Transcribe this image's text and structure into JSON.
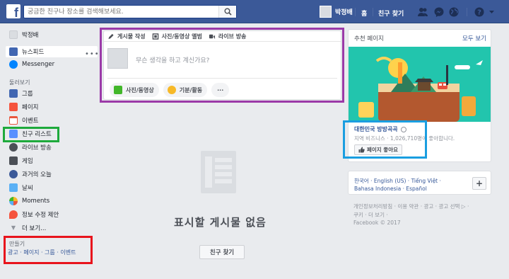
{
  "topbar": {
    "search_placeholder": "궁금한 친구나 장소를 검색해보세요.",
    "user_name": "박정배",
    "home": "홈",
    "find_friends": "친구 찾기"
  },
  "sidebar": {
    "profile_name": "박정배",
    "items_top": [
      {
        "label": "뉴스피드",
        "icon": "newsfeed-icon",
        "color": "#4267b2"
      },
      {
        "label": "Messenger",
        "icon": "messenger-icon",
        "color": "#0084ff"
      }
    ],
    "explore_title": "둘러보기",
    "items": [
      {
        "label": "그룹",
        "icon": "groups-icon",
        "color": "#4267b2"
      },
      {
        "label": "페이지",
        "icon": "pages-icon",
        "color": "#f5533d"
      },
      {
        "label": "이벤트",
        "icon": "events-icon",
        "color": "#e9573e"
      },
      {
        "label": "친구 리스트",
        "icon": "friend-list-icon",
        "color": "#5890ff"
      },
      {
        "label": "라이브 방송",
        "icon": "live-icon",
        "color": "#4b4f56"
      },
      {
        "label": "게임",
        "icon": "games-icon",
        "color": "#4b4f56"
      },
      {
        "label": "과거의 오늘",
        "icon": "on-this-day-icon",
        "color": "#3b5998"
      },
      {
        "label": "날씨",
        "icon": "weather-icon",
        "color": "#5ab0f5"
      },
      {
        "label": "Moments",
        "icon": "moments-icon",
        "color": "#f7b928"
      },
      {
        "label": "정보 수정 제안",
        "icon": "suggest-edits-icon",
        "color": "#f5533d"
      },
      {
        "label": "더 보기...",
        "icon": "see-more-icon",
        "color": "#90949c"
      }
    ],
    "create_title": "만들기",
    "create_links": "광고 · 페이지 · 그룹 · 이벤트"
  },
  "composer": {
    "tabs": [
      "게시물 작성",
      "사진/동영상 앨범",
      "라이브 방송"
    ],
    "placeholder": "무슨 생각을 하고 계신가요?",
    "actions": [
      "사진/동영상",
      "기분/활동",
      "···"
    ]
  },
  "feed": {
    "empty_text": "표시할 게시물 없음",
    "find_friends_button": "친구 찾기"
  },
  "recommended": {
    "title": "추천 페이지",
    "see_all": "모두 보기",
    "page_name": "대한민국 방방곡곡",
    "page_meta": "지역 비즈니스 · 1,026,710명이 좋아합니다.",
    "like_button": "페이지 좋아요"
  },
  "languages": {
    "line1": "한국어 · English (US) · Tiếng Việt ·",
    "line2": "Bahasa Indonesia · Español",
    "add": "+"
  },
  "footer": {
    "line1": "개인정보처리방침 · 이용 약관 · 광고 · 광고 선택 ▷ ·",
    "line2": "쿠키 · 더 보기 ·",
    "line3": "Facebook © 2017"
  },
  "colors": {
    "brand": "#3b5998",
    "highlight_purple": "#9b3aa8",
    "highlight_green": "#1eaa3c",
    "highlight_red": "#e8141c",
    "highlight_blue": "#1a9ee0"
  }
}
